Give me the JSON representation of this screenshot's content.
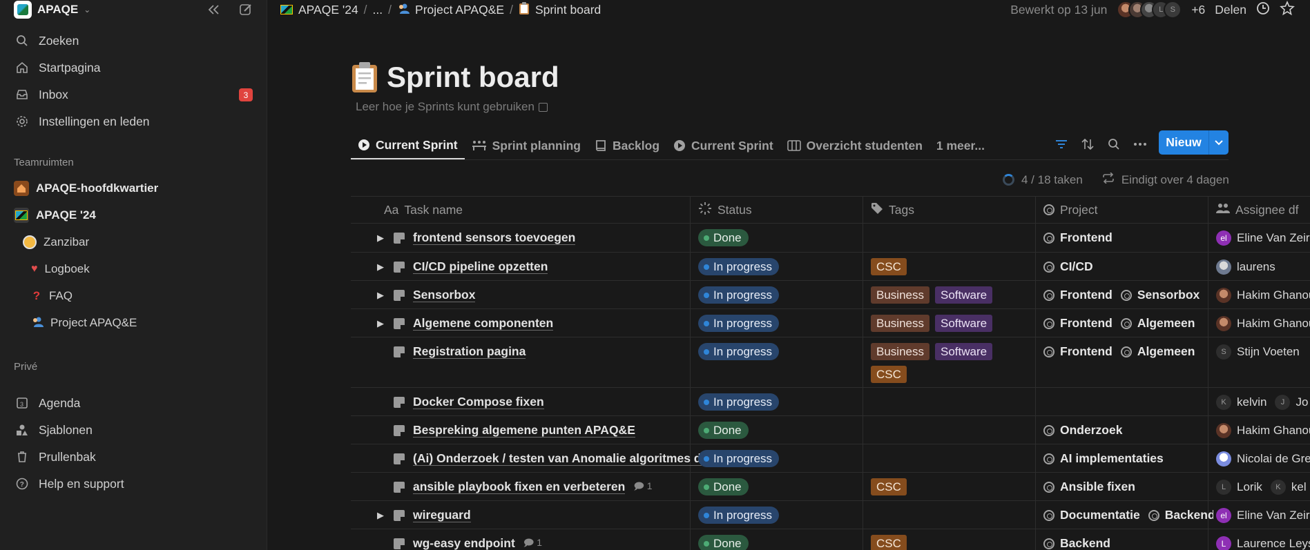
{
  "workspace": {
    "name": "APAQE"
  },
  "sidebar": {
    "nav": [
      {
        "label": "Zoeken",
        "icon": "search-icon"
      },
      {
        "label": "Startpagina",
        "icon": "home-icon"
      },
      {
        "label": "Inbox",
        "icon": "inbox-icon",
        "badge": "3"
      },
      {
        "label": "Instellingen en leden",
        "icon": "gear-icon"
      }
    ],
    "teamspaces_label": "Teamruimten",
    "teamspaces": [
      {
        "label": "APAQE-hoofdkwartier",
        "icon": "house-icon"
      },
      {
        "label": "APAQE '24",
        "icon": "flag-icon"
      },
      {
        "label": "Zanzibar",
        "icon": "clock-icon"
      },
      {
        "label": "Logboek",
        "icon": "anatomical-heart-icon"
      },
      {
        "label": "FAQ",
        "icon": "question-mark-icon"
      },
      {
        "label": "Project APAQ&E",
        "icon": "people-icon"
      }
    ],
    "private_label": "Privé",
    "bottom": [
      {
        "label": "Agenda",
        "icon": "calendar-icon"
      },
      {
        "label": "Sjablonen",
        "icon": "templates-icon"
      },
      {
        "label": "Prullenbak",
        "icon": "trash-icon"
      },
      {
        "label": "Help en support",
        "icon": "help-icon"
      }
    ]
  },
  "topbar": {
    "crumbs": [
      "APAQE '24",
      "...",
      "Project APAQ&E",
      "Sprint board"
    ],
    "edited": "Bewerkt op 13 jun",
    "more_count": "+6",
    "share": "Delen"
  },
  "page": {
    "title": "Sprint board",
    "subtitle": "Leer hoe je Sprints kunt gebruiken",
    "tabs": [
      {
        "label": "Current Sprint",
        "icon": "play-icon",
        "active": true
      },
      {
        "label": "Sprint planning",
        "icon": "people-chart-icon"
      },
      {
        "label": "Backlog",
        "icon": "book-icon"
      },
      {
        "label": "Current Sprint",
        "icon": "play-icon"
      },
      {
        "label": "Overzicht studenten",
        "icon": "columns-icon"
      },
      {
        "label": "1 meer..."
      }
    ],
    "new_button": "Nieuw",
    "sprint_tasks": "4 / 18 taken",
    "sprint_ends": "Eindigt over 4 dagen",
    "columns": {
      "name": "Task name",
      "name_prefix": "Aa",
      "status": "Status",
      "tags": "Tags",
      "project": "Project",
      "assignee": "Assignee df"
    },
    "rows": [
      {
        "name": "frontend sensors toevoegen",
        "caret": true,
        "status": "Done",
        "status_kind": "done",
        "tags": [],
        "projects": [
          "Frontend"
        ],
        "assignees": [
          {
            "initials": "el",
            "style": "purple",
            "name": "Eline Van Zeir"
          }
        ]
      },
      {
        "name": "CI/CD pipeline opzetten",
        "caret": true,
        "status": "In progress",
        "status_kind": "prog",
        "tags": [
          "CSC"
        ],
        "projects": [
          "CI/CD"
        ],
        "assignees": [
          {
            "initials": "",
            "style": "photo2",
            "name": "laurens"
          }
        ]
      },
      {
        "name": "Sensorbox",
        "caret": true,
        "status": "In progress",
        "status_kind": "prog",
        "tags": [
          "Business",
          "Software"
        ],
        "projects": [
          "Frontend",
          "Sensorbox"
        ],
        "assignees": [
          {
            "initials": "",
            "style": "photo",
            "name": "Hakim Ghanou"
          }
        ]
      },
      {
        "name": "Algemene componenten",
        "caret": true,
        "status": "In progress",
        "status_kind": "prog",
        "tags": [
          "Business",
          "Software"
        ],
        "projects": [
          "Frontend",
          "Algemeen"
        ],
        "assignees": [
          {
            "initials": "",
            "style": "photo",
            "name": "Hakim Ghanou"
          }
        ]
      },
      {
        "name": "Registration pagina",
        "caret": false,
        "status": "In progress",
        "status_kind": "prog",
        "tags": [
          "Business",
          "Software",
          "CSC"
        ],
        "projects": [
          "Frontend",
          "Algemeen"
        ],
        "assignees": [
          {
            "initials": "S",
            "style": "plain",
            "name": "Stijn Voeten"
          }
        ]
      },
      {
        "name": "Docker Compose fixen",
        "caret": false,
        "status": "In progress",
        "status_kind": "prog",
        "tags": [],
        "projects": [],
        "assignees": [
          {
            "initials": "K",
            "style": "plain",
            "name": "kelvin"
          },
          {
            "initials": "J",
            "style": "plain",
            "name": "Jo"
          }
        ]
      },
      {
        "name": "Bespreking algemene punten APAQ&E",
        "caret": false,
        "status": "Done",
        "status_kind": "done",
        "tags": [],
        "projects": [
          "Onderzoek"
        ],
        "assignees": [
          {
            "initials": "",
            "style": "photo",
            "name": "Hakim Ghanou"
          }
        ]
      },
      {
        "name": "(Ai) Onderzoek / testen van Anomalie algoritmes d",
        "caret": false,
        "status": "In progress",
        "status_kind": "prog",
        "tags": [],
        "projects": [
          "AI implementaties"
        ],
        "assignees": [
          {
            "initials": "",
            "style": "photo3",
            "name": "Nicolai de Gre"
          }
        ]
      },
      {
        "name": "ansible playbook fixen en verbeteren",
        "caret": false,
        "comments": "1",
        "status": "Done",
        "status_kind": "done",
        "tags": [
          "CSC"
        ],
        "projects": [
          "Ansible fixen"
        ],
        "assignees": [
          {
            "initials": "L",
            "style": "plain",
            "name": "Lorik"
          },
          {
            "initials": "K",
            "style": "plain",
            "name": "kel"
          }
        ]
      },
      {
        "name": "wireguard",
        "caret": true,
        "status": "In progress",
        "status_kind": "prog",
        "tags": [],
        "projects": [
          "Documentatie",
          "Backend"
        ],
        "assignees": [
          {
            "initials": "el",
            "style": "purple",
            "name": "Eline Van Zeir"
          }
        ]
      },
      {
        "name": "wg-easy endpoint",
        "caret": false,
        "comments": "1",
        "status": "Done",
        "status_kind": "done",
        "tags": [
          "CSC"
        ],
        "projects": [
          "Backend"
        ],
        "assignees": [
          {
            "initials": "L",
            "style": "purple",
            "name": "Laurence Leys"
          }
        ]
      }
    ]
  }
}
